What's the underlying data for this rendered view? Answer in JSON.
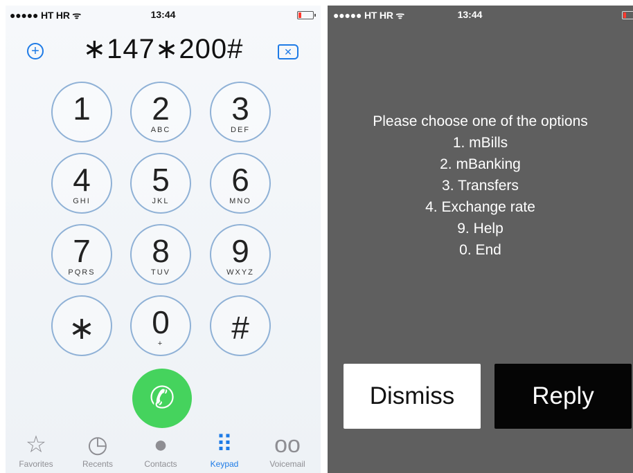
{
  "left_phone": {
    "status_bar": {
      "carrier": "●●●●● HT HR ᯤ",
      "time": "13:44"
    },
    "dialed_number": "∗147∗200#",
    "add_label": "⊕",
    "keys": [
      {
        "digit": "1",
        "letters": ""
      },
      {
        "digit": "2",
        "letters": "ABC"
      },
      {
        "digit": "3",
        "letters": "DEF"
      },
      {
        "digit": "4",
        "letters": "GHI"
      },
      {
        "digit": "5",
        "letters": "JKL"
      },
      {
        "digit": "6",
        "letters": "MNO"
      },
      {
        "digit": "7",
        "letters": "PQRS"
      },
      {
        "digit": "8",
        "letters": "TUV"
      },
      {
        "digit": "9",
        "letters": "WXYZ"
      },
      {
        "digit": "∗",
        "letters": ""
      },
      {
        "digit": "0",
        "letters": "+"
      },
      {
        "digit": "#",
        "letters": ""
      }
    ],
    "tabs": [
      {
        "label": "Favorites",
        "icon": "☆"
      },
      {
        "label": "Recents",
        "icon": "◷"
      },
      {
        "label": "Contacts",
        "icon": "●"
      },
      {
        "label": "Keypad",
        "icon": "⠿"
      },
      {
        "label": "Voicemail",
        "icon": "oo"
      }
    ],
    "accent_color": "#1e7be6",
    "call_color": "#45d35d"
  },
  "right_phone": {
    "status_bar": {
      "carrier": "●●●●● HT HR ᯤ",
      "time": "13:44"
    },
    "message_lines": [
      "Please choose one of the options",
      "1. mBills",
      "2. mBanking",
      "3. Transfers",
      "4. Exchange rate",
      "9. Help",
      "0. End"
    ],
    "dismiss_label": "Dismiss",
    "reply_label": "Reply"
  }
}
